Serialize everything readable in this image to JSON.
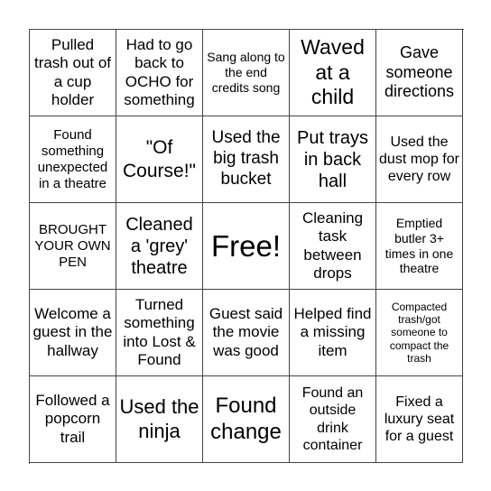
{
  "card": {
    "cells": [
      [
        "Pulled trash out of a cup holder",
        "Had to go back to OCHO for something",
        "Sang along to the end credits song",
        "Waved at a child",
        "Gave someone directions"
      ],
      [
        "Found something unexpected in a theatre",
        "\"Of Course!\"",
        "Used the big trash bucket",
        "Put trays in back hall",
        "Used the dust mop for every row"
      ],
      [
        "BROUGHT YOUR OWN PEN",
        "Cleaned a 'grey' theatre",
        "Free!",
        "Cleaning task between drops",
        "Emptied butler 3+ times in one theatre"
      ],
      [
        "Welcome a guest in the hallway",
        "Turned something into Lost & Found",
        "Guest said the movie was good",
        "Helped find a missing item",
        "Compacted trash/got someone to compact the trash"
      ],
      [
        "Followed a popcorn trail",
        "Used the ninja",
        "Found change",
        "Found an outside drink container",
        "Fixed a luxury seat for a guest"
      ]
    ]
  }
}
